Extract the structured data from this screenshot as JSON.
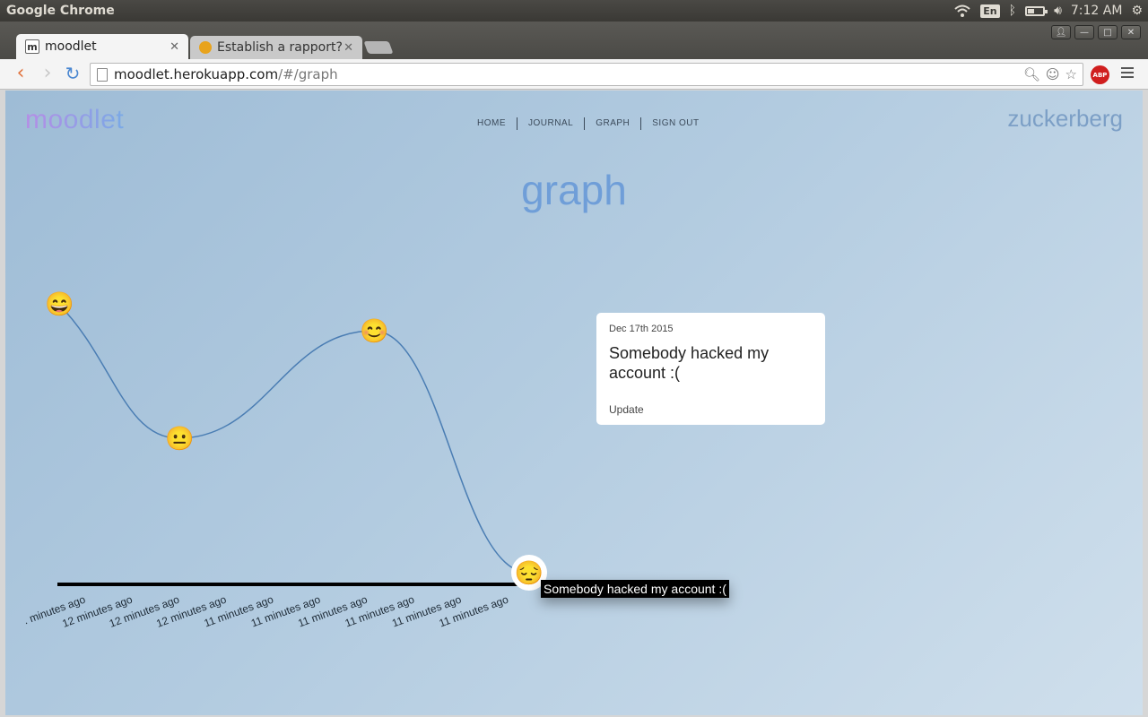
{
  "os_panel": {
    "app_name": "Google Chrome",
    "keyboard_layout": "En",
    "time": "7:12 AM",
    "icons": [
      "wifi-icon",
      "bluetooth-icon",
      "battery-icon",
      "volume-icon",
      "settings-gear-icon"
    ]
  },
  "browser": {
    "tabs": [
      {
        "title": "moodlet",
        "favicon": "m",
        "active": true
      },
      {
        "title": "Establish a rapport?",
        "favicon": "yellow-bird",
        "active": false
      }
    ],
    "url": {
      "host": "moodlet.herokuapp.com",
      "path": "/#/graph"
    },
    "extension_badge": "ABP"
  },
  "page": {
    "logo": "moodlet",
    "nav": [
      "HOME",
      "JOURNAL",
      "GRAPH",
      "SIGN OUT"
    ],
    "username": "zuckerberg",
    "title": "graph",
    "tooltip": "Somebody hacked my account :(",
    "card": {
      "date": "Dec 17th 2015",
      "entry": "Somebody hacked my account :(",
      "action": "Update"
    }
  },
  "chart_data": {
    "type": "line",
    "mood_points": [
      {
        "emoji": "😄",
        "level": 4
      },
      {
        "emoji": "😐",
        "level": 2
      },
      {
        "emoji": "😊",
        "level": 3.6
      },
      {
        "emoji": "😔",
        "level": 0,
        "selected": true
      }
    ],
    "x_tick_labels": [
      ". minutes ago",
      "12 minutes ago",
      "12 minutes ago",
      "12 minutes ago",
      "11 minutes ago",
      "11 minutes ago",
      "11 minutes ago",
      "11 minutes ago",
      "11 minutes ago",
      "11 minutes ago"
    ],
    "line_color": "#4a7db3",
    "axis_color": "#000000"
  }
}
